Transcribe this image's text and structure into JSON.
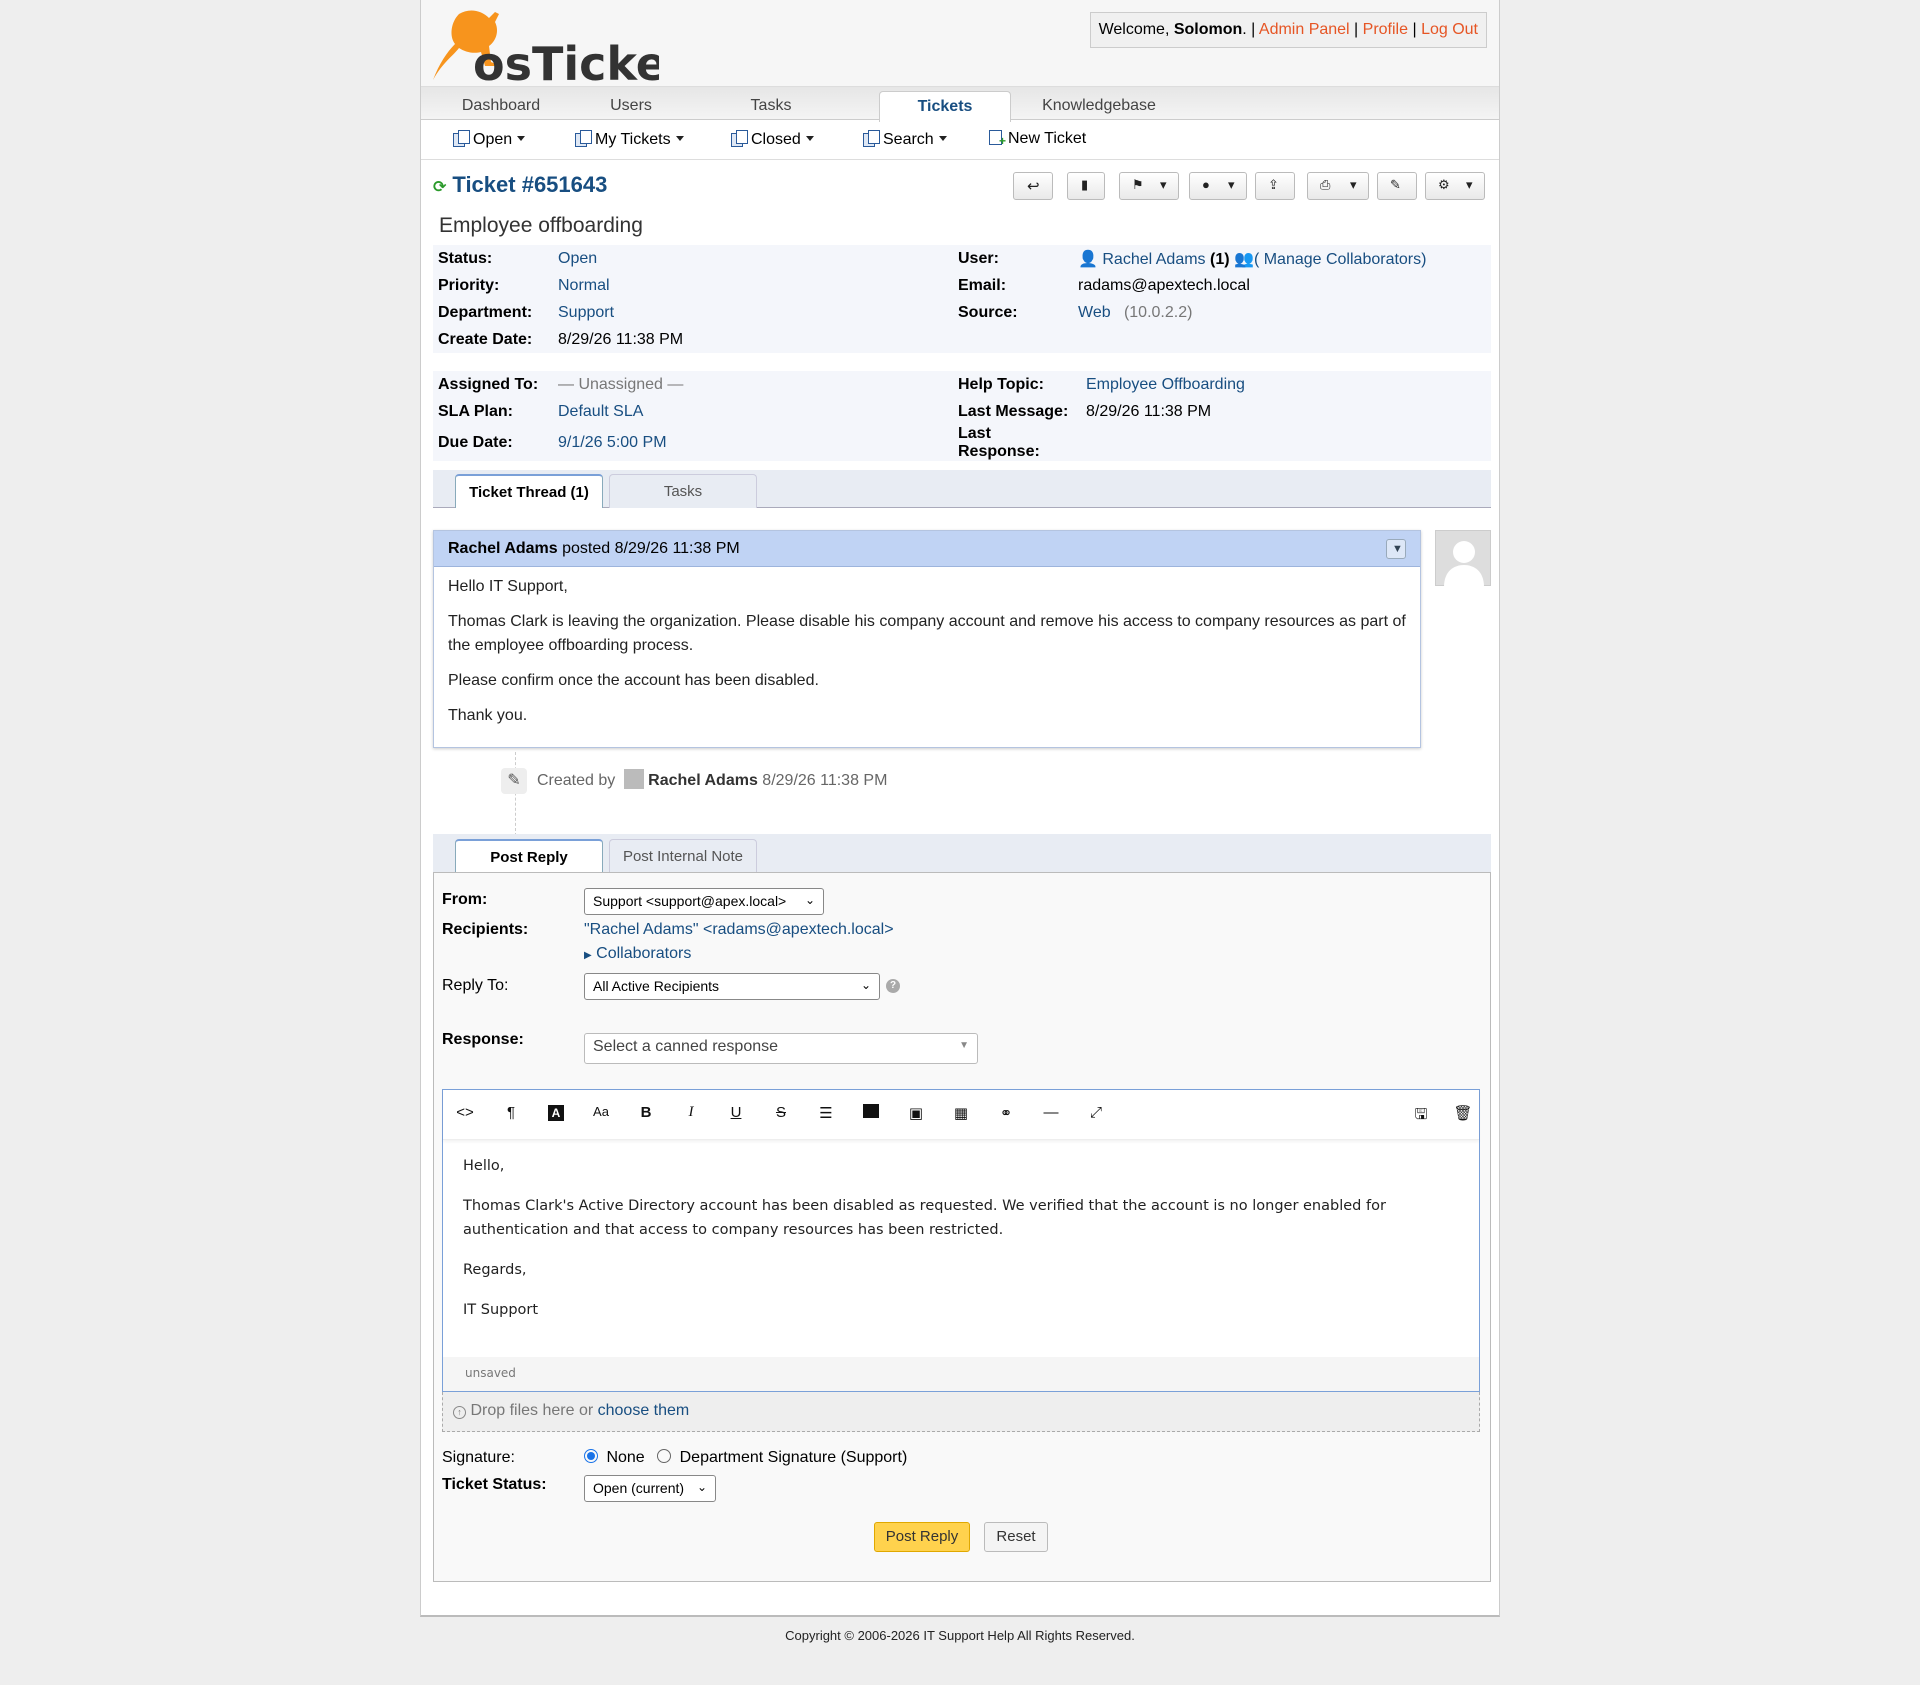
{
  "header": {
    "logo_text": "osTicket",
    "welcome_prefix": "Welcome, ",
    "username": "Solomon",
    "links": [
      "Admin Panel",
      "Profile",
      "Log Out"
    ]
  },
  "nav": {
    "tabs": [
      "Dashboard",
      "Users",
      "Tasks",
      "Tickets",
      "Knowledgebase"
    ],
    "active": "Tickets"
  },
  "subnav": [
    "Open",
    "My Tickets",
    "Closed",
    "Search",
    "New Ticket"
  ],
  "ticket": {
    "title": "Ticket #651643",
    "subject": "Employee offboarding",
    "status_label": "Status:",
    "status": "Open",
    "priority_label": "Priority:",
    "priority": "Normal",
    "department_label": "Department:",
    "department": "Support",
    "create_date_label": "Create Date:",
    "create_date": "8/29/26 11:38 PM",
    "user_label": "User:",
    "user": "Rachel Adams",
    "user_count": "(1)",
    "manage_collab": "( Manage Collaborators)",
    "email_label": "Email:",
    "email": "radams@apextech.local",
    "source_label": "Source:",
    "source": "Web",
    "source_ip": "(10.0.2.2)",
    "assigned_label": "Assigned To:",
    "assigned": "— Unassigned —",
    "sla_label": "SLA Plan:",
    "sla": "Default SLA",
    "due_label": "Due Date:",
    "due": "9/1/26 5:00 PM",
    "topic_label": "Help Topic:",
    "topic": "Employee Offboarding",
    "last_msg_label": "Last Message:",
    "last_msg": "8/29/26 11:38 PM",
    "last_resp_label": "Last Response:",
    "last_resp": ""
  },
  "thread_tabs": [
    "Ticket Thread (1)",
    "Tasks"
  ],
  "entry": {
    "author": "Rachel Adams",
    "posted": "posted 8/29/26 11:38 PM",
    "paragraphs": [
      "Hello IT Support,",
      "Thomas Clark is leaving the organization. Please disable his company account and remove his access to company resources as part of the employee offboarding process.",
      "Please confirm once the account has been disabled.",
      "Thank you."
    ]
  },
  "event": {
    "created_by": "Created by",
    "author": "Rachel Adams",
    "time": "8/29/26 11:38 PM"
  },
  "reply_tabs": [
    "Post Reply",
    "Post Internal Note"
  ],
  "reply": {
    "from_label": "From:",
    "from_value": "Support <support@apex.local>",
    "recipients_label": "Recipients:",
    "recipient": "\"Rachel Adams\" <radams@apextech.local>",
    "collaborators": "Collaborators",
    "reply_to_label": "Reply To:",
    "reply_to_value": "All Active Recipients",
    "response_label": "Response:",
    "response_placeholder": "Select a canned response",
    "editor_paragraphs": [
      "Hello,",
      "Thomas Clark's Active Directory account has been disabled as requested. We verified that the account is no longer enabled for authentication and that access to company resources has been restricted.",
      "Regards,",
      "IT Support"
    ],
    "editor_status": "unsaved",
    "drop_text": "Drop files here or ",
    "drop_link": "choose them",
    "signature_label": "Signature:",
    "sig_none": "None",
    "sig_dept": "Department Signature (Support)",
    "status_label": "Ticket Status:",
    "status_value": "Open (current)",
    "post_button": "Post Reply",
    "reset_button": "Reset"
  },
  "footer": "Copyright © 2006-2026 IT Support Help All Rights Reserved.",
  "colors": {
    "accent_link": "#184E81",
    "header_link": "#E65524",
    "post_button": "#FFD24D",
    "thread_head": "#C0D3F4"
  }
}
